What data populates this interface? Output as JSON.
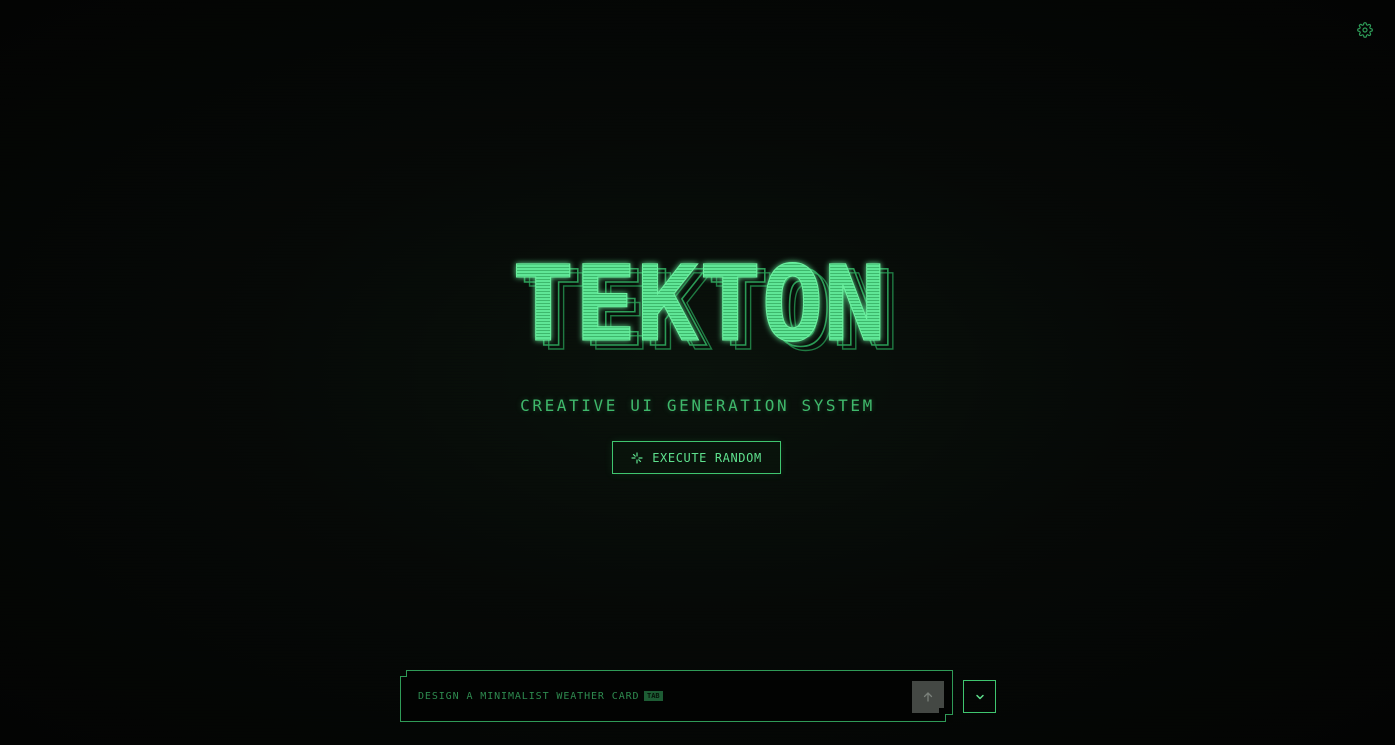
{
  "logo": {
    "text": "TEKTON"
  },
  "subtitle": "CREATIVE UI GENERATION SYSTEM",
  "actions": {
    "execute_random_label": "EXECUTE RANDOM"
  },
  "prompt": {
    "placeholder": "DESIGN A MINIMALIST WEATHER CARD",
    "value": "",
    "tab_hint": "TAB"
  },
  "icons": {
    "settings": "gear-icon",
    "execute": "sparkle-icon",
    "send": "arrow-up-icon",
    "dropdown": "chevron-down-icon"
  },
  "colors": {
    "accent": "#3fc56f",
    "logo_fill": "#4fd98a",
    "background": "#040604",
    "send_button": "#444844"
  }
}
